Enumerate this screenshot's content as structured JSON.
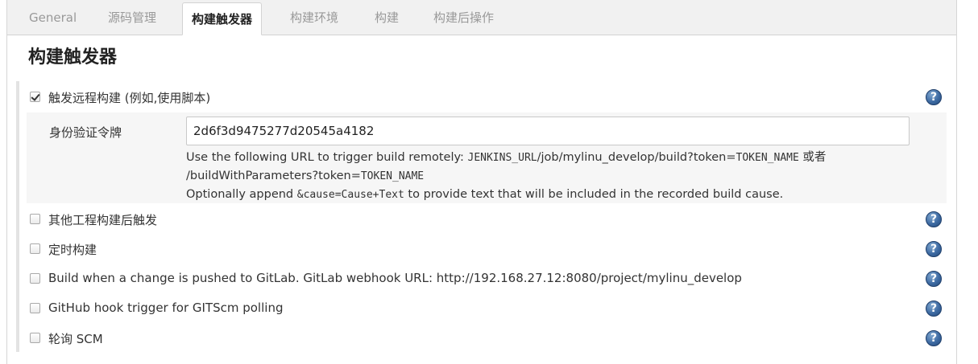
{
  "tabs": [
    "General",
    "源码管理",
    "构建触发器",
    "构建环境",
    "构建",
    "构建后操作"
  ],
  "active_tab_index": 2,
  "section_title": "构建触发器",
  "remote_trigger": {
    "label": "触发远程构建 (例如,使用脚本)",
    "checked": true,
    "token_label": "身份验证令牌",
    "token_value": "2d6f3d9475277d20545a4182",
    "desc1_prefix": "Use the following URL to trigger build remotely: ",
    "desc1_code": "JENKINS_URL",
    "desc1_mid": "/job/mylinu_develop/build?token=",
    "desc1_code2": "TOKEN_NAME",
    "desc1_suffix": " 或者",
    "desc2_prefix": "/buildWithParameters?token=",
    "desc2_code": "TOKEN_NAME",
    "desc3_prefix": "Optionally append ",
    "desc3_code": "&cause=Cause+Text",
    "desc3_suffix": " to provide text that will be included in the recorded build cause."
  },
  "triggers": [
    {
      "label": "其他工程构建后触发",
      "checked": false
    },
    {
      "label": "定时构建",
      "checked": false
    },
    {
      "label": "Build when a change is pushed to GitLab. GitLab webhook URL: http://192.168.27.12:8080/project/mylinu_develop",
      "checked": false
    },
    {
      "label": "GitHub hook trigger for GITScm polling",
      "checked": false
    },
    {
      "label": "轮询 SCM",
      "checked": false
    }
  ],
  "help_glyph": "?",
  "colors": {
    "help_icon": "#3d6aa2",
    "tab_bar": "#f1f1f1",
    "token_box": "#f6f6f6"
  }
}
